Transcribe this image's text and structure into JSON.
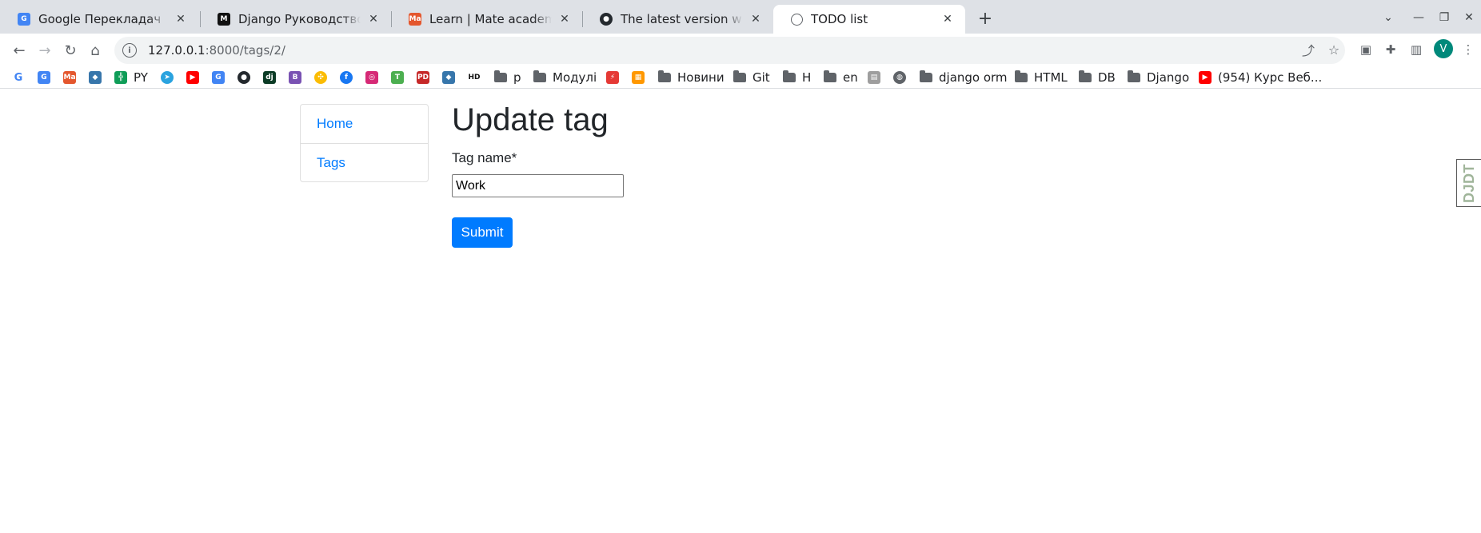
{
  "tabs": [
    {
      "title": "Google Перекладач",
      "active": false
    },
    {
      "title": "Django Руководство часть",
      "active": false
    },
    {
      "title": "Learn | Mate academy",
      "active": false
    },
    {
      "title": "The latest version with rem",
      "active": false
    },
    {
      "title": "TODO list",
      "active": true
    }
  ],
  "address": {
    "host": "127.0.0.1",
    "path": ":8000/tags/2/"
  },
  "bookmarks": [
    "PY",
    "p",
    "Модулі",
    "Новини",
    "Git",
    "H",
    "en",
    "django orm",
    "HTML",
    "DB",
    "Django",
    "(954) Курс Веб..."
  ],
  "icons": {
    "mate_badge": "Ma",
    "hd_badge": "HD",
    "dj_badge": "dj",
    "b_badge": "B",
    "t_badge": "T",
    "pd_badge": "PD"
  },
  "profile": {
    "initial": "V"
  },
  "sidebar": {
    "items": [
      "Home",
      "Tags"
    ]
  },
  "page": {
    "heading": "Update tag"
  },
  "form": {
    "label": "Tag name*",
    "value": "Work",
    "submit": "Submit"
  },
  "debug_toolbar": {
    "label": "DJDT"
  },
  "colors": {
    "link": "#007bff",
    "primary": "#007bff",
    "tabstrip": "#dee1e6"
  }
}
